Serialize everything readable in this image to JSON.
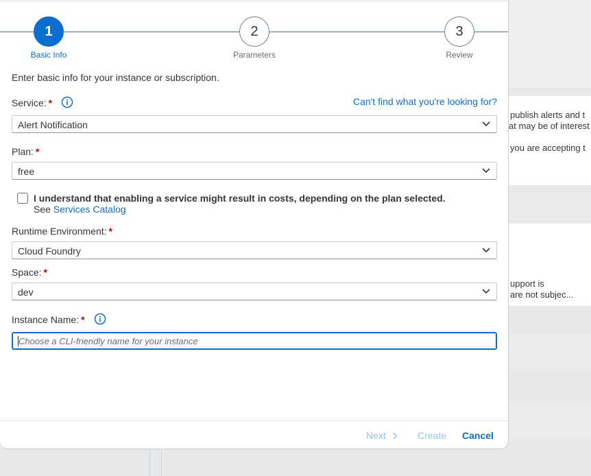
{
  "wizard": {
    "steps": [
      {
        "number": "1",
        "label": "Basic Info",
        "active": true
      },
      {
        "number": "2",
        "label": "Parameters",
        "active": false
      },
      {
        "number": "3",
        "label": "Review",
        "active": false
      }
    ]
  },
  "form": {
    "intro": "Enter basic info for your instance or subscription.",
    "help_link": "Can't find what you're looking for?",
    "service": {
      "label": "Service:",
      "required": "*",
      "value": "Alert Notification"
    },
    "plan": {
      "label": "Plan:",
      "required": "*",
      "value": "free"
    },
    "cost_ack": {
      "text": "I understand that enabling a service might result in costs, depending on the plan selected.",
      "see": "See",
      "link": "Services Catalog",
      "checked": false
    },
    "runtime": {
      "label": "Runtime Environment:",
      "required": "*",
      "value": "Cloud Foundry"
    },
    "space": {
      "label": "Space:",
      "required": "*",
      "value": "dev"
    },
    "instance_name": {
      "label": "Instance Name:",
      "required": "*",
      "value": "",
      "placeholder": "Choose a CLI-friendly name for your instance"
    }
  },
  "footer": {
    "next": "Next",
    "create": "Create",
    "cancel": "Cancel"
  },
  "background": {
    "line1": "publish alerts and t",
    "line2": "at may be of interest",
    "line3": "you are accepting t",
    "line4": "upport is",
    "line5": "are not subjec..."
  },
  "colors": {
    "accent": "#0a6ed1",
    "required": "#bb0000",
    "disabled": "#97c0e8"
  }
}
